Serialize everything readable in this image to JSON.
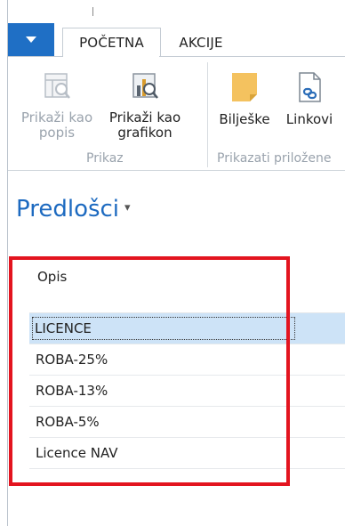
{
  "tabs": {
    "file_menu_icon": "chevron-down-icon",
    "active": "POČETNA",
    "other": "AKCIJE"
  },
  "ribbon": {
    "groups": [
      {
        "label": "Prikaz",
        "buttons": [
          {
            "label_line1": "Prikaži kao",
            "label_line2": "popis",
            "icon": "list-view-icon",
            "enabled": false
          },
          {
            "label_line1": "Prikaži kao",
            "label_line2": "grafikon",
            "icon": "chart-view-icon",
            "enabled": true
          }
        ]
      },
      {
        "label": "Prikazati priložene",
        "buttons": [
          {
            "label_line1": "Bilješke",
            "icon": "note-icon",
            "enabled": true
          },
          {
            "label_line1": "Linkovi",
            "icon": "link-document-icon",
            "enabled": true
          }
        ]
      }
    ]
  },
  "page": {
    "title": "Predlošci",
    "title_dropdown": "▾"
  },
  "table": {
    "column_header": "Opis",
    "rows": [
      "LICENCE",
      "ROBA-25%",
      "ROBA-13%",
      "ROBA-5%",
      "Licence NAV"
    ],
    "selected_index": 0
  },
  "colors": {
    "accent": "#1f6fc5",
    "title": "#1d6ac0",
    "selection": "#cde3f7",
    "highlight_box": "#e3141f"
  }
}
